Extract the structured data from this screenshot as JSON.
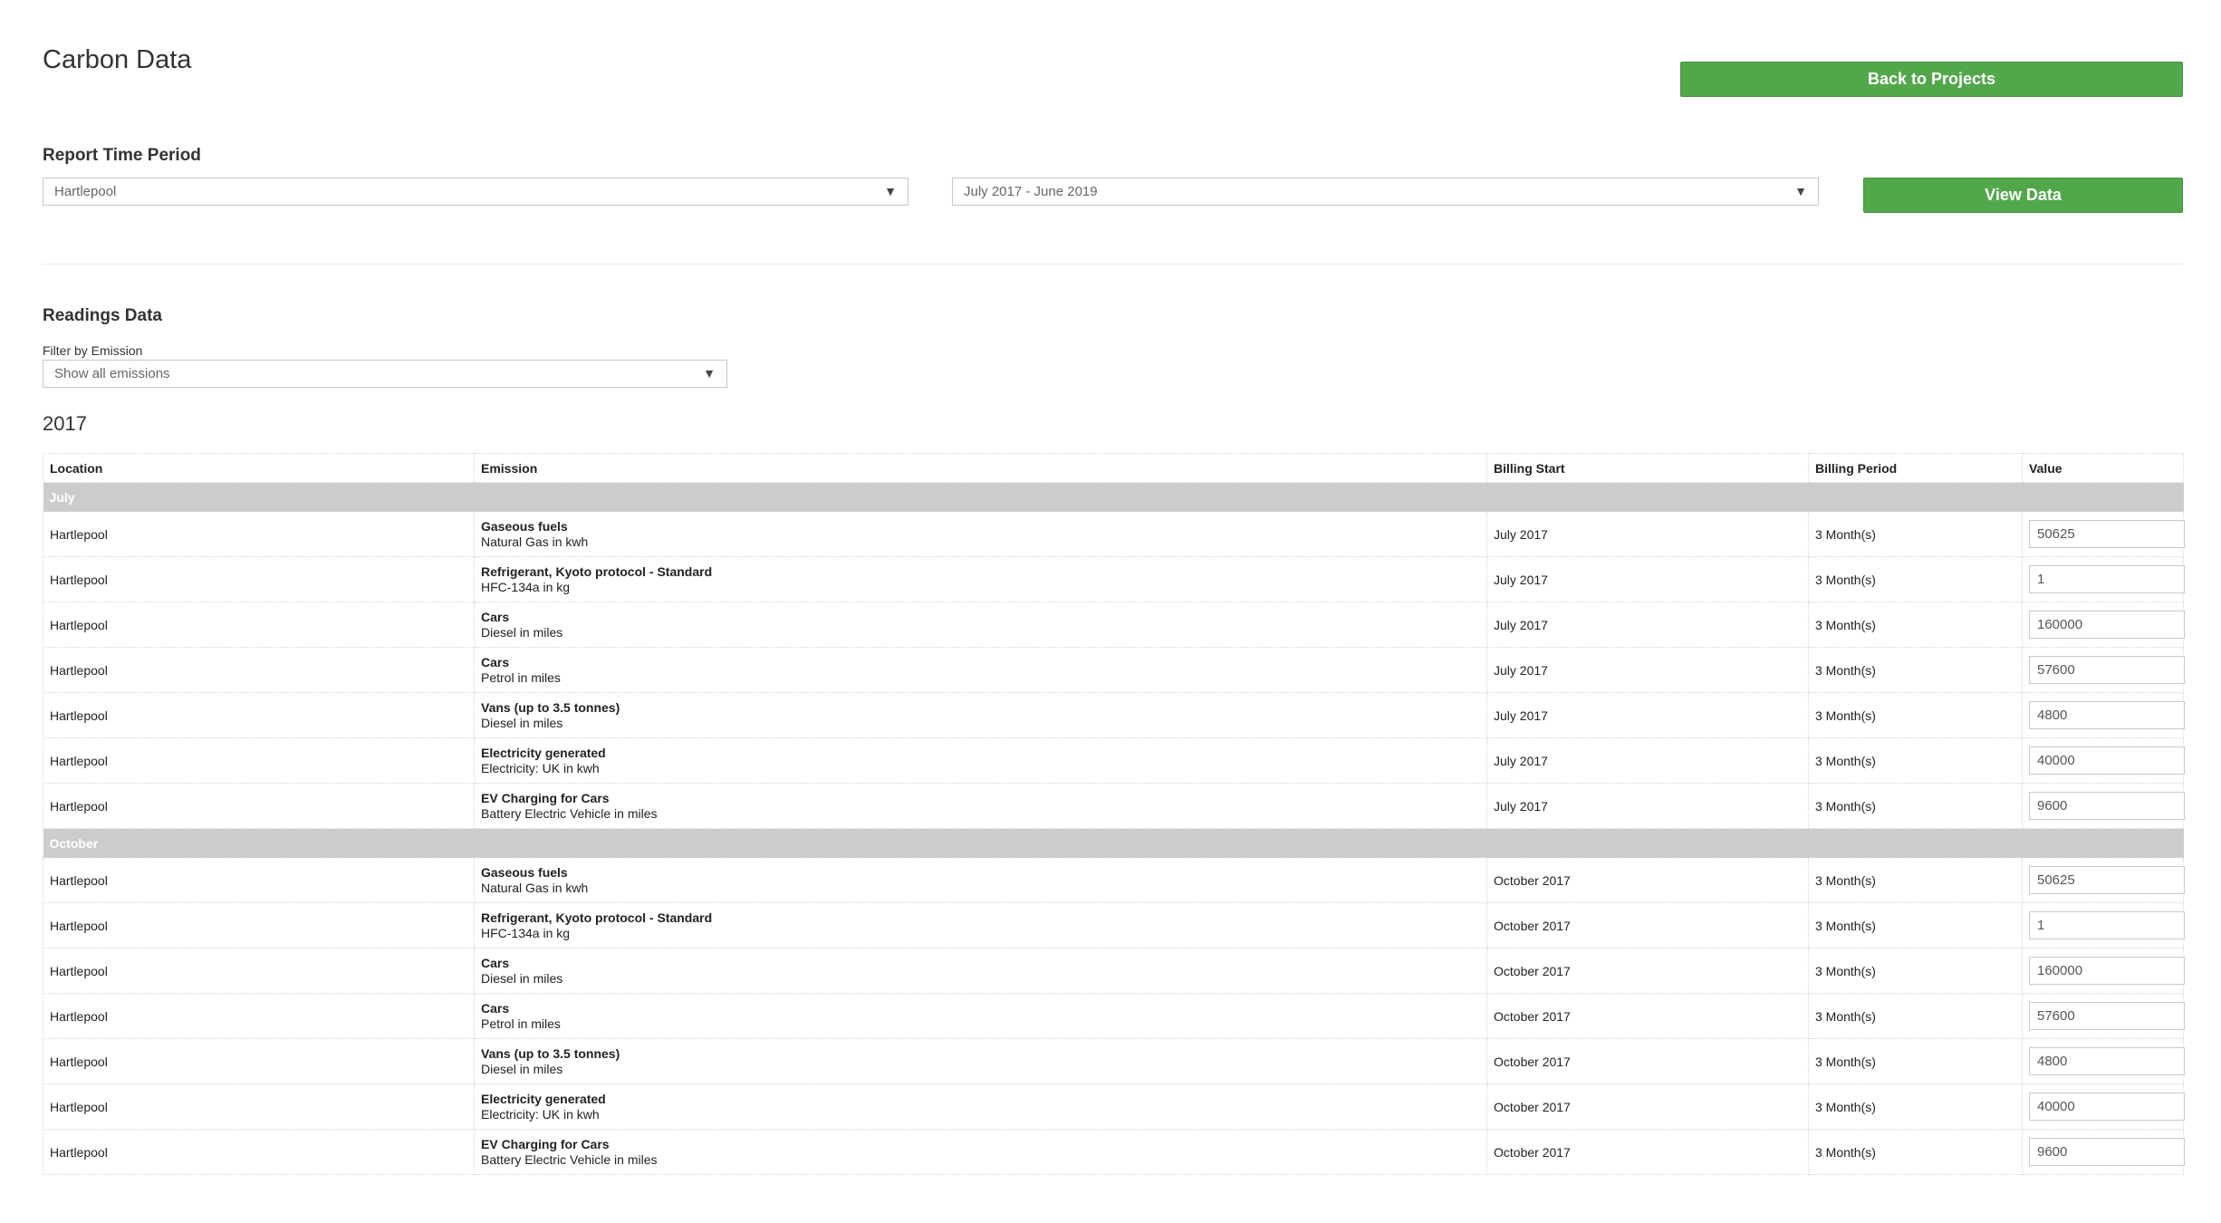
{
  "header": {
    "title": "Carbon Data",
    "back_button": "Back to Projects"
  },
  "report": {
    "label": "Report Time Period",
    "location": "Hartlepool",
    "period": "July 2017 - June 2019",
    "view_button": "View Data"
  },
  "readings": {
    "label": "Readings Data",
    "filter_label": "Filter by Emission",
    "filter_value": "Show all emissions",
    "year": "2017",
    "columns": [
      "Location",
      "Emission",
      "Billing Start",
      "Billing Period",
      "Value"
    ],
    "groups": [
      {
        "name": "July",
        "rows": [
          {
            "location": "Hartlepool",
            "type": "Gaseous fuels",
            "unit": "Natural Gas in kwh",
            "start": "July 2017",
            "period": "3 Month(s)",
            "value": "50625"
          },
          {
            "location": "Hartlepool",
            "type": "Refrigerant, Kyoto protocol - Standard",
            "unit": "HFC-134a in kg",
            "start": "July 2017",
            "period": "3 Month(s)",
            "value": "1"
          },
          {
            "location": "Hartlepool",
            "type": "Cars",
            "unit": "Diesel in miles",
            "start": "July 2017",
            "period": "3 Month(s)",
            "value": "160000"
          },
          {
            "location": "Hartlepool",
            "type": "Cars",
            "unit": "Petrol in miles",
            "start": "July 2017",
            "period": "3 Month(s)",
            "value": "57600"
          },
          {
            "location": "Hartlepool",
            "type": "Vans (up to 3.5 tonnes)",
            "unit": "Diesel in miles",
            "start": "July 2017",
            "period": "3 Month(s)",
            "value": "4800"
          },
          {
            "location": "Hartlepool",
            "type": "Electricity generated",
            "unit": "Electricity: UK in kwh",
            "start": "July 2017",
            "period": "3 Month(s)",
            "value": "40000"
          },
          {
            "location": "Hartlepool",
            "type": "EV Charging for Cars",
            "unit": "Battery Electric Vehicle in miles",
            "start": "July 2017",
            "period": "3 Month(s)",
            "value": "9600"
          }
        ]
      },
      {
        "name": "October",
        "rows": [
          {
            "location": "Hartlepool",
            "type": "Gaseous fuels",
            "unit": "Natural Gas in kwh",
            "start": "October 2017",
            "period": "3 Month(s)",
            "value": "50625"
          },
          {
            "location": "Hartlepool",
            "type": "Refrigerant, Kyoto protocol - Standard",
            "unit": "HFC-134a in kg",
            "start": "October 2017",
            "period": "3 Month(s)",
            "value": "1"
          },
          {
            "location": "Hartlepool",
            "type": "Cars",
            "unit": "Diesel in miles",
            "start": "October 2017",
            "period": "3 Month(s)",
            "value": "160000"
          },
          {
            "location": "Hartlepool",
            "type": "Cars",
            "unit": "Petrol in miles",
            "start": "October 2017",
            "period": "3 Month(s)",
            "value": "57600"
          },
          {
            "location": "Hartlepool",
            "type": "Vans (up to 3.5 tonnes)",
            "unit": "Diesel in miles",
            "start": "October 2017",
            "period": "3 Month(s)",
            "value": "4800"
          },
          {
            "location": "Hartlepool",
            "type": "Electricity generated",
            "unit": "Electricity: UK in kwh",
            "start": "October 2017",
            "period": "3 Month(s)",
            "value": "40000"
          },
          {
            "location": "Hartlepool",
            "type": "EV Charging for Cars",
            "unit": "Battery Electric Vehicle in miles",
            "start": "October 2017",
            "period": "3 Month(s)",
            "value": "9600"
          }
        ]
      }
    ]
  },
  "icons": {
    "dropdown_caret": "▼"
  },
  "colors": {
    "accent_green": "#52a74b",
    "group_header_bg": "#cccccc"
  }
}
